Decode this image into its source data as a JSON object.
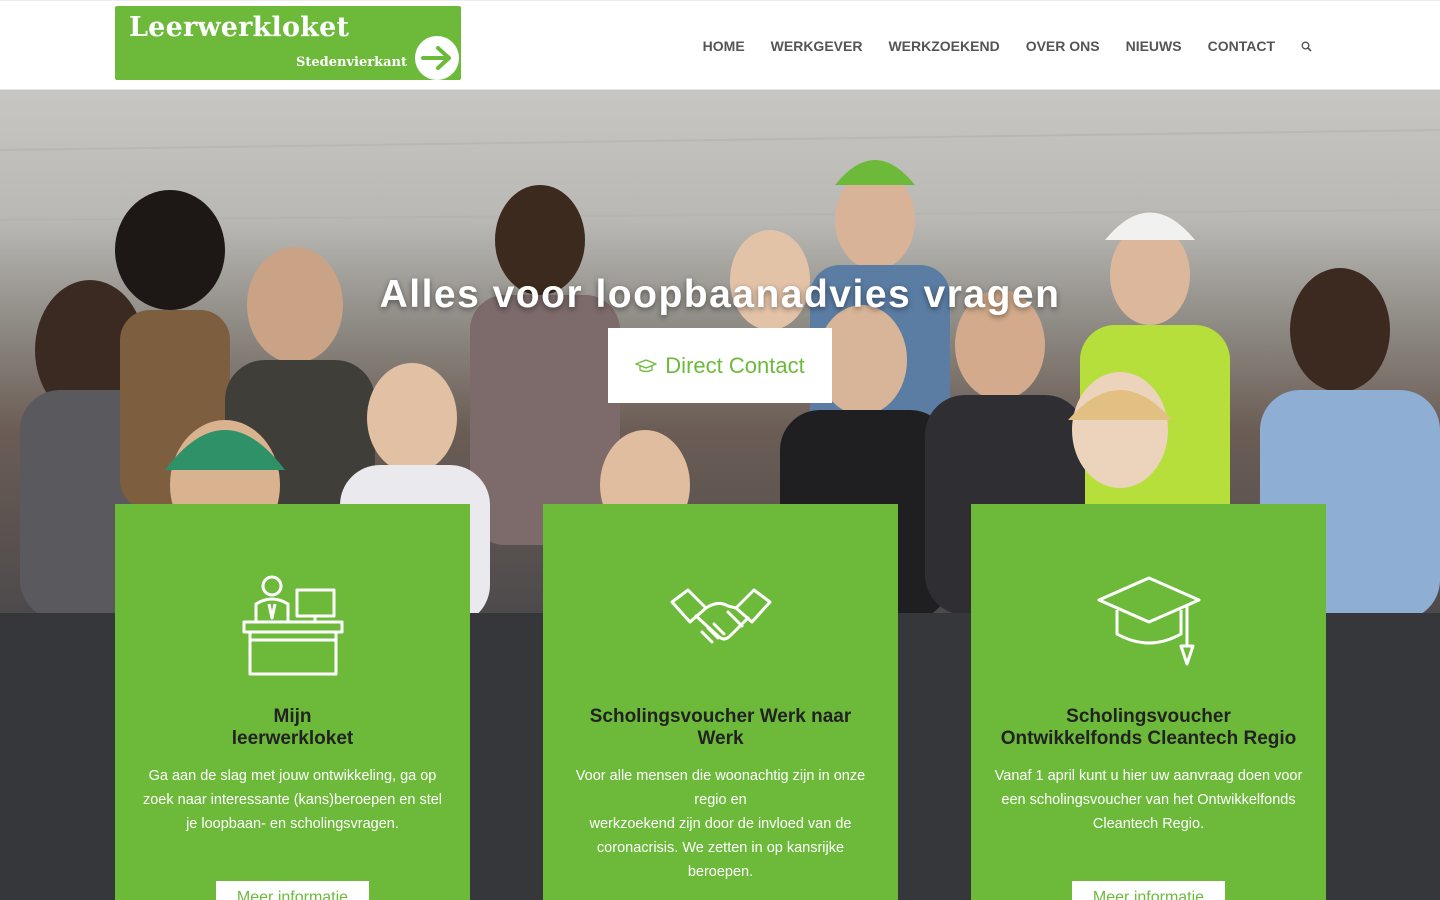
{
  "header": {
    "logo_title": "Leerwerkloket",
    "logo_subtitle": "Stedenvierkant",
    "nav": [
      "HOME",
      "WERKGEVER",
      "WERKZOEKEND",
      "OVER ONS",
      "NIEUWS",
      "CONTACT"
    ]
  },
  "hero": {
    "title": "Alles voor loopbaanadvies vragen",
    "button_label": "Direct Contact"
  },
  "cards": [
    {
      "title_line1": "Mijn",
      "title_line2": "leerwerkloket",
      "text": "Ga aan de slag met jouw ontwikkeling, ga op zoek naar interessante (kans)beroepen en stel je loopbaan- en scholingsvragen.",
      "button": "Meer informatie",
      "icon": "desk-icon"
    },
    {
      "title_line1": "Scholingsvoucher Werk naar",
      "title_line2": "Werk",
      "text_line1": "Voor alle mensen die woonachtig zijn in onze regio en",
      "text_line2": "werkzoekend zijn door de invloed van de coronacrisis. We zetten in op kansrijke beroepen.",
      "button": "Meer informatie",
      "icon": "handshake-icon"
    },
    {
      "title_line1": "Scholingsvoucher",
      "title_line2": "Ontwikkelfonds Cleantech Regio",
      "text": "Vanaf 1 april kunt u hier uw aanvraag doen voor een scholingsvoucher van het Ontwikkelfonds Cleantech Regio.",
      "button": "Meer informatie",
      "icon": "graduation-cap-icon"
    }
  ],
  "colors": {
    "brand_green": "#6dba3b",
    "dark_band": "#35373b"
  }
}
